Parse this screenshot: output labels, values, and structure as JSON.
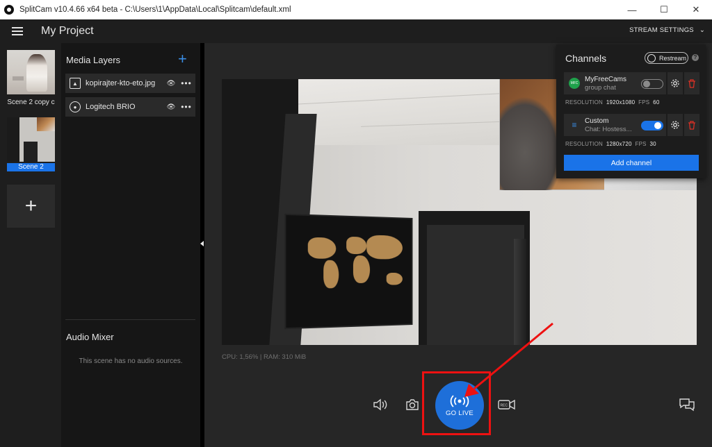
{
  "window": {
    "title": "SplitCam v10.4.66 x64 beta - C:\\Users\\1\\AppData\\Local\\Splitcam\\default.xml",
    "minimize": "—",
    "maximize": "☐",
    "close": "✕"
  },
  "header": {
    "project_title": "My Project",
    "stream_settings": "STREAM SETTINGS",
    "stream_settings_chevron": "⌄"
  },
  "scenes": {
    "items": [
      {
        "label": "Scene 2 copy c",
        "active": false
      },
      {
        "label": "Scene 2",
        "active": true
      }
    ],
    "add_symbol": "+"
  },
  "layers": {
    "title": "Media Layers",
    "add_symbol": "+",
    "items": [
      {
        "name": "kopirajter-kto-eto.jpg",
        "icon": "image-icon",
        "eye": "👁",
        "more": "•••"
      },
      {
        "name": "Logitech BRIO",
        "icon": "webcam-icon",
        "eye": "👁",
        "more": "•••"
      }
    ]
  },
  "audio": {
    "title": "Audio Mixer",
    "empty_text": "This scene has no audio sources."
  },
  "status": {
    "cpu_ram": "CPU: 1,56% | RAM: 310 MiB"
  },
  "controls": {
    "go_live_label": "GO LIVE",
    "icons": [
      "speaker-icon",
      "camera-icon",
      "broadcast-icon",
      "record-icon",
      "chat-icon"
    ]
  },
  "channels": {
    "title": "Channels",
    "restream_label": "Restream",
    "help": "?",
    "add_channel_label": "Add channel",
    "items": [
      {
        "name": "MyFreeCams",
        "subtitle": "group chat",
        "enabled": false,
        "icon_color": "#1fa14b",
        "icon_text": "MFC",
        "resolution_label": "RESOLUTION",
        "resolution": "1920x1080",
        "fps_label": "FPS",
        "fps": "60"
      },
      {
        "name": "Custom",
        "subtitle": "Chat: Hostess...",
        "enabled": true,
        "icon_color": "#3a8ee6",
        "icon_text": "≡",
        "resolution_label": "RESOLUTION",
        "resolution": "1280x720",
        "fps_label": "FPS",
        "fps": "30"
      }
    ]
  },
  "colors": {
    "accent": "#1a73e8",
    "highlight": "#ee1111",
    "delete": "#d93025"
  }
}
